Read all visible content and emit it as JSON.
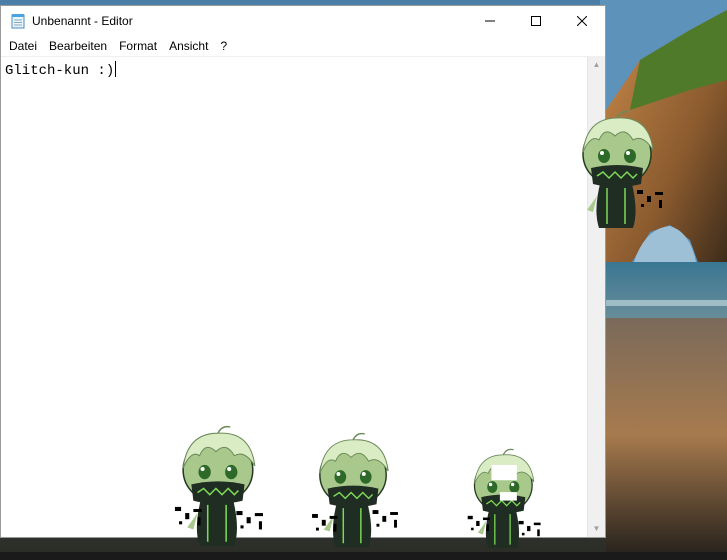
{
  "window": {
    "title": "Unbenannt - Editor",
    "controls": {
      "minimize": "—",
      "maximize": "☐",
      "close": "✕"
    }
  },
  "menu": {
    "items": [
      "Datei",
      "Bearbeiten",
      "Format",
      "Ansicht",
      "?"
    ]
  },
  "editor": {
    "text": "Glitch-kun :)"
  },
  "scrollbar": {
    "up_arrow": "▲",
    "down_arrow": "▼"
  },
  "icons": {
    "app": "notepad-icon",
    "mascot": "glitch-kun-mascot"
  },
  "colors": {
    "mascot_skin": "#a9c98c",
    "mascot_hair": "#d9ecc4",
    "mascot_body": "#1f2d22",
    "mascot_accent": "#7ed957"
  }
}
